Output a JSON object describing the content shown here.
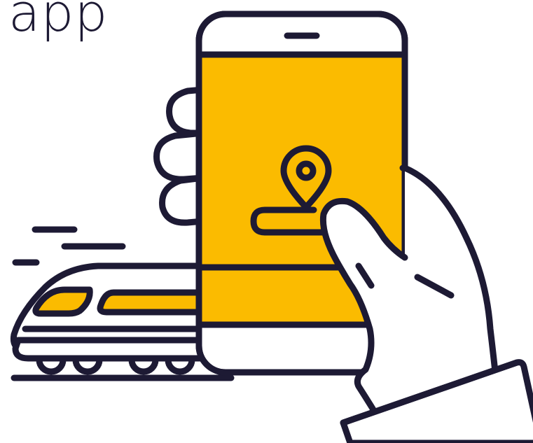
{
  "heading": {
    "text": "app"
  },
  "colors": {
    "ink": "#1d1a34",
    "accent": "#fbbb00",
    "background": "#ffffff"
  },
  "icons": [
    "train-icon",
    "smartphone-icon",
    "map-pin-icon",
    "hand-icon",
    "sleeve-icon"
  ]
}
